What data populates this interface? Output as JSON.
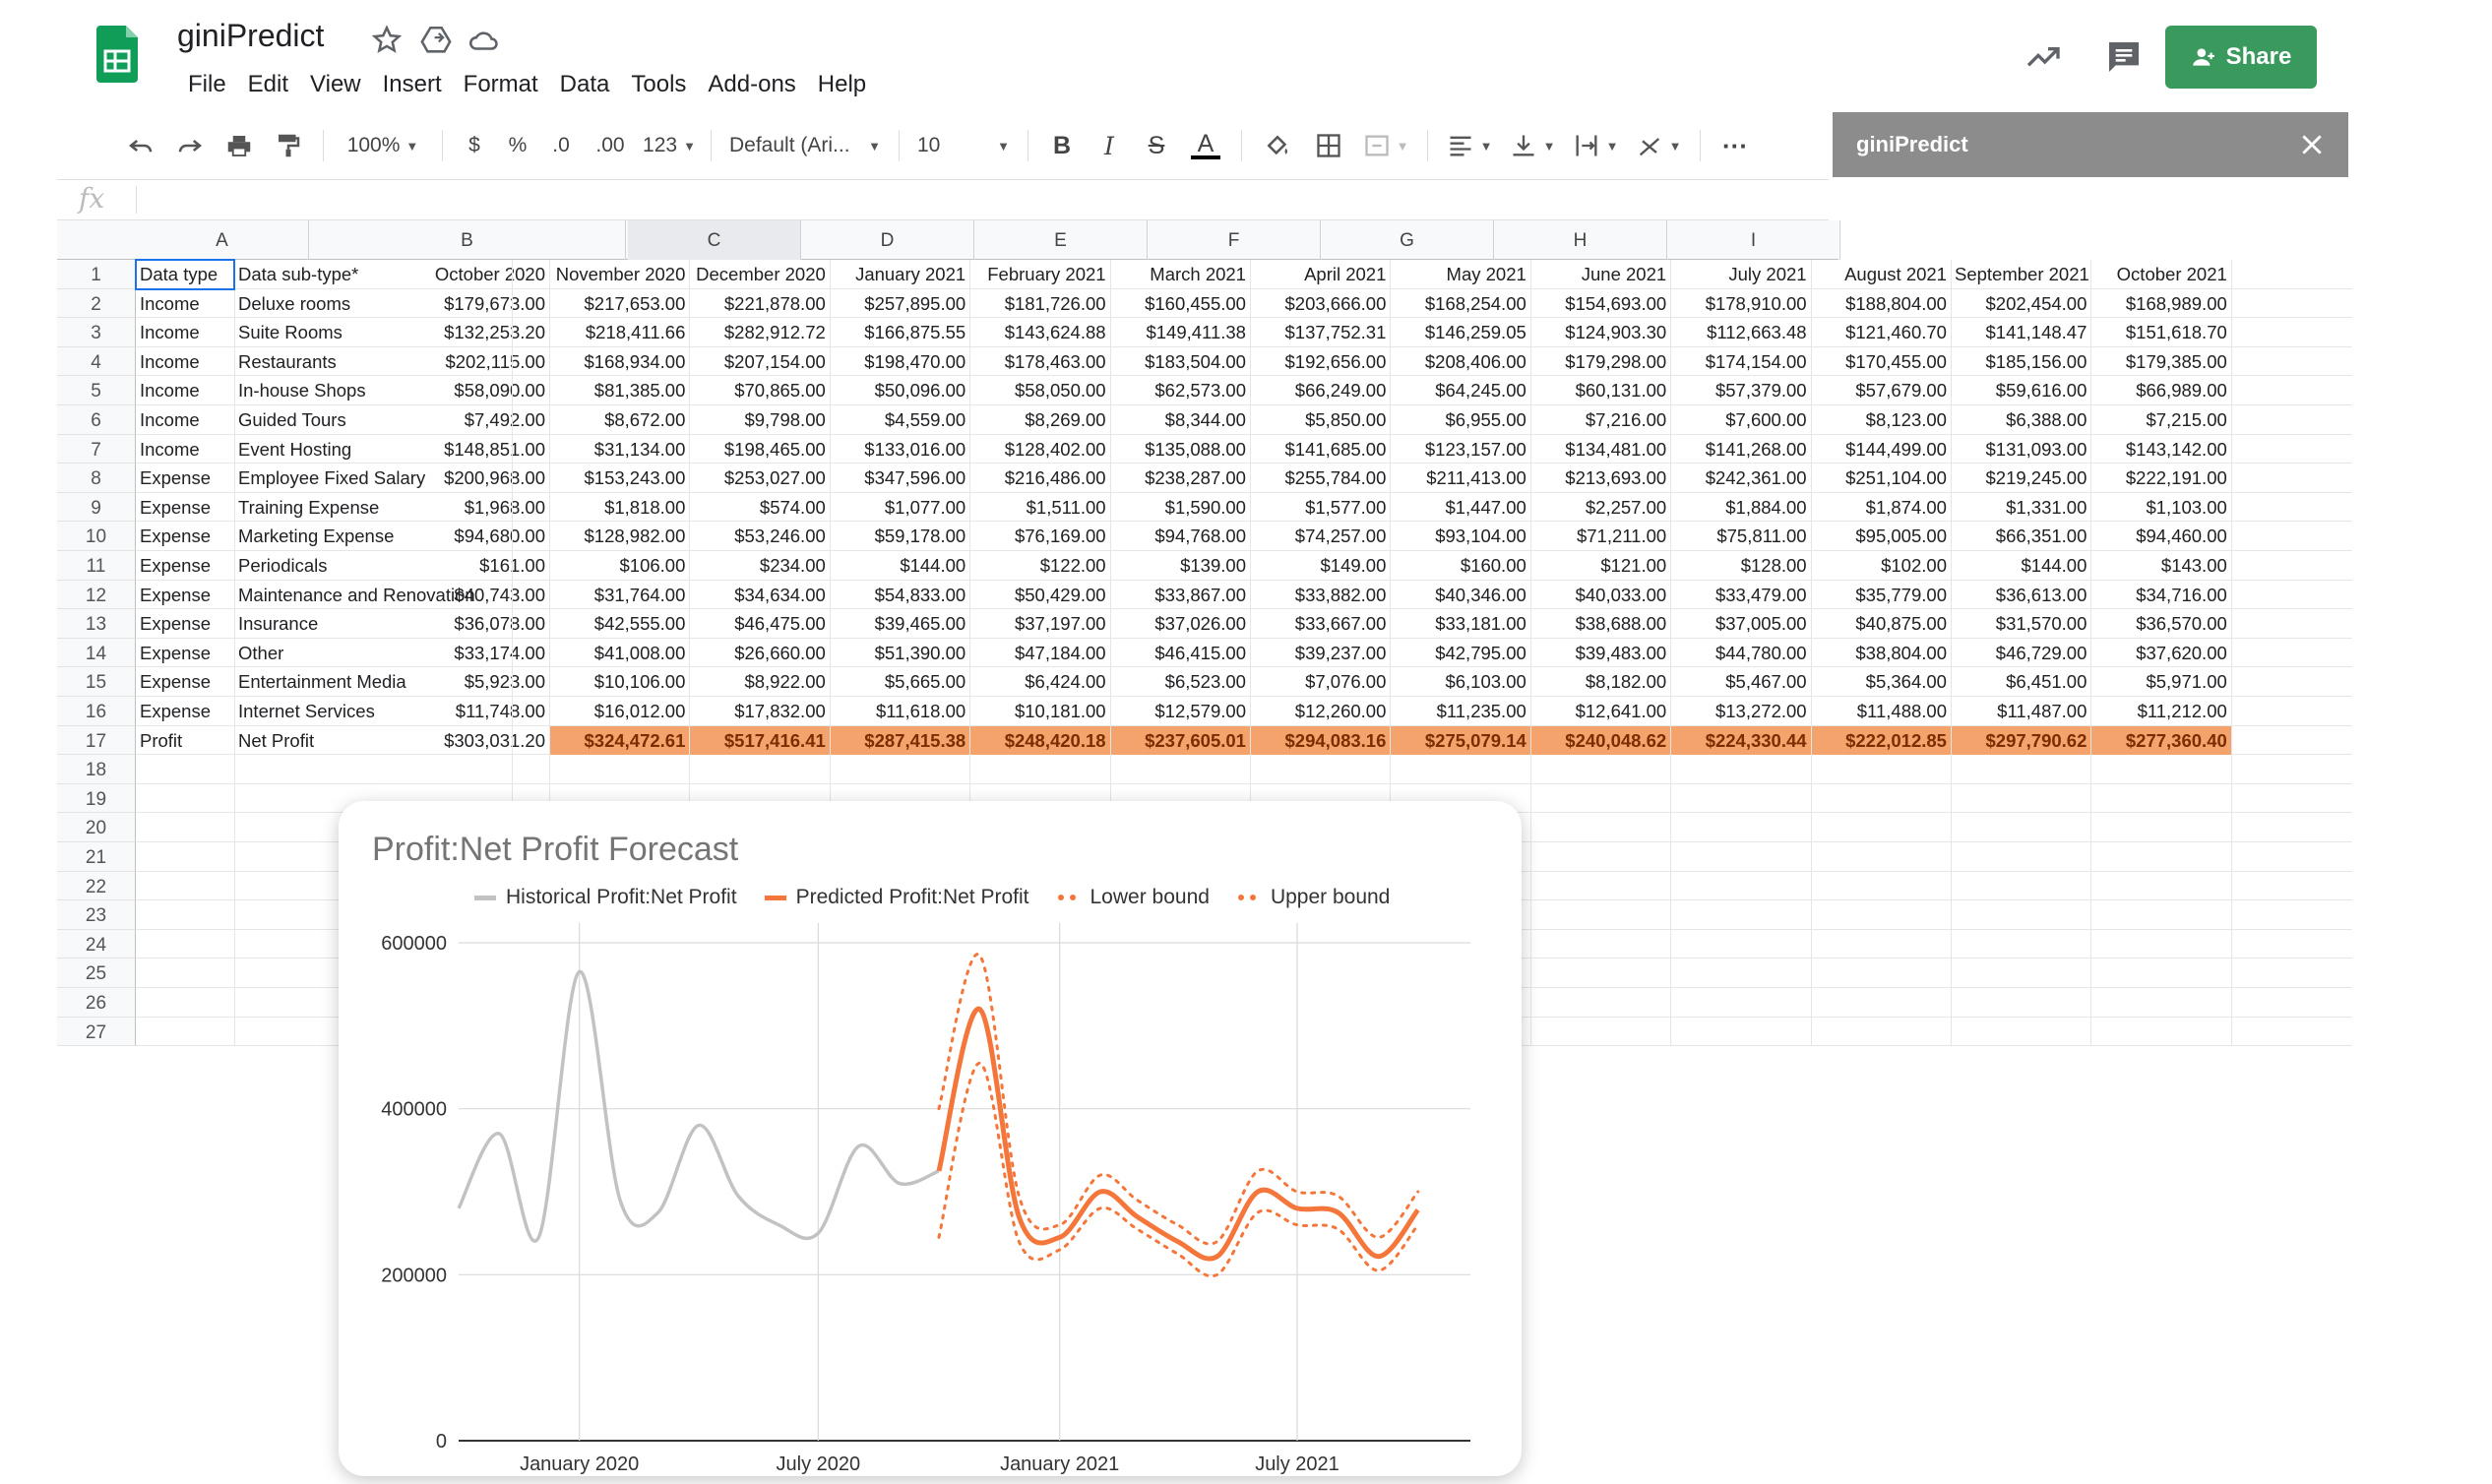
{
  "app": {
    "title": "giniPredict",
    "menus": [
      "File",
      "Edit",
      "View",
      "Insert",
      "Format",
      "Data",
      "Tools",
      "Add-ons",
      "Help"
    ],
    "share_label": "Share",
    "brand_color": "#0f9d58",
    "share_color": "#3a9a5d",
    "icons": [
      "star-icon",
      "move-to-drive-icon",
      "cloud-status-icon",
      "explore-trend-icon",
      "comments-icon"
    ]
  },
  "toolbar": {
    "zoom": "100%",
    "currency": "$",
    "percent": "%",
    "decrease_decimal": ".0",
    "increase_decimal": ".00",
    "more_formats": "123",
    "font": "Default (Ari...",
    "font_size": "10",
    "bold": "B",
    "italic": "I",
    "strike": "S",
    "text_color": "A",
    "more": "···"
  },
  "side_panel": {
    "title": "giniPredict"
  },
  "formula_bar": {
    "fx": "fx"
  },
  "grid": {
    "column_letters": [
      "A",
      "B",
      "C",
      "D",
      "E",
      "F",
      "G",
      "H",
      "I"
    ],
    "row_numbers": [
      "1",
      "2",
      "3",
      "4",
      "5",
      "6",
      "7",
      "8",
      "9",
      "10",
      "11",
      "12",
      "13",
      "14",
      "15",
      "16",
      "17",
      "18",
      "19",
      "20",
      "21",
      "22",
      "23",
      "24",
      "25",
      "26",
      "27"
    ],
    "headers": [
      "Data type",
      "Data sub-type*",
      "October 2020",
      "November 2020",
      "December 2020",
      "January 2021",
      "February 2021",
      "March 2021",
      "April 2021",
      "May 2021",
      "June 2021",
      "July 2021",
      "August 2021",
      "September 2021",
      "October 2021"
    ],
    "rows": [
      [
        "Income",
        "Deluxe rooms",
        "$179,673.00",
        "$217,653.00",
        "$221,878.00",
        "$257,895.00",
        "$181,726.00",
        "$160,455.00",
        "$203,666.00",
        "$168,254.00",
        "$154,693.00",
        "$178,910.00",
        "$188,804.00",
        "$202,454.00",
        "$168,989.00"
      ],
      [
        "Income",
        "Suite Rooms",
        "$132,253.20",
        "$218,411.66",
        "$282,912.72",
        "$166,875.55",
        "$143,624.88",
        "$149,411.38",
        "$137,752.31",
        "$146,259.05",
        "$124,903.30",
        "$112,663.48",
        "$121,460.70",
        "$141,148.47",
        "$151,618.70"
      ],
      [
        "Income",
        "Restaurants",
        "$202,115.00",
        "$168,934.00",
        "$207,154.00",
        "$198,470.00",
        "$178,463.00",
        "$183,504.00",
        "$192,656.00",
        "$208,406.00",
        "$179,298.00",
        "$174,154.00",
        "$170,455.00",
        "$185,156.00",
        "$179,385.00"
      ],
      [
        "Income",
        "In-house Shops",
        "$58,090.00",
        "$81,385.00",
        "$70,865.00",
        "$50,096.00",
        "$58,050.00",
        "$62,573.00",
        "$66,249.00",
        "$64,245.00",
        "$60,131.00",
        "$57,379.00",
        "$57,679.00",
        "$59,616.00",
        "$66,989.00"
      ],
      [
        "Income",
        "Guided Tours",
        "$7,492.00",
        "$8,672.00",
        "$9,798.00",
        "$4,559.00",
        "$8,269.00",
        "$8,344.00",
        "$5,850.00",
        "$6,955.00",
        "$7,216.00",
        "$7,600.00",
        "$8,123.00",
        "$6,388.00",
        "$7,215.00"
      ],
      [
        "Income",
        "Event Hosting",
        "$148,851.00",
        "$31,134.00",
        "$198,465.00",
        "$133,016.00",
        "$128,402.00",
        "$135,088.00",
        "$141,685.00",
        "$123,157.00",
        "$134,481.00",
        "$141,268.00",
        "$144,499.00",
        "$131,093.00",
        "$143,142.00"
      ],
      [
        "Expense",
        "Employee Fixed Salary",
        "$200,968.00",
        "$153,243.00",
        "$253,027.00",
        "$347,596.00",
        "$216,486.00",
        "$238,287.00",
        "$255,784.00",
        "$211,413.00",
        "$213,693.00",
        "$242,361.00",
        "$251,104.00",
        "$219,245.00",
        "$222,191.00"
      ],
      [
        "Expense",
        "Training Expense",
        "$1,968.00",
        "$1,818.00",
        "$574.00",
        "$1,077.00",
        "$1,511.00",
        "$1,590.00",
        "$1,577.00",
        "$1,447.00",
        "$2,257.00",
        "$1,884.00",
        "$1,874.00",
        "$1,331.00",
        "$1,103.00"
      ],
      [
        "Expense",
        "Marketing Expense",
        "$94,680.00",
        "$128,982.00",
        "$53,246.00",
        "$59,178.00",
        "$76,169.00",
        "$94,768.00",
        "$74,257.00",
        "$93,104.00",
        "$71,211.00",
        "$75,811.00",
        "$95,005.00",
        "$66,351.00",
        "$94,460.00"
      ],
      [
        "Expense",
        "Periodicals",
        "$161.00",
        "$106.00",
        "$234.00",
        "$144.00",
        "$122.00",
        "$139.00",
        "$149.00",
        "$160.00",
        "$121.00",
        "$128.00",
        "$102.00",
        "$144.00",
        "$143.00"
      ],
      [
        "Expense",
        "Maintenance and Renovation",
        "$40,743.00",
        "$31,764.00",
        "$34,634.00",
        "$54,833.00",
        "$50,429.00",
        "$33,867.00",
        "$33,882.00",
        "$40,346.00",
        "$40,033.00",
        "$33,479.00",
        "$35,779.00",
        "$36,613.00",
        "$34,716.00"
      ],
      [
        "Expense",
        "Insurance",
        "$36,078.00",
        "$42,555.00",
        "$46,475.00",
        "$39,465.00",
        "$37,197.00",
        "$37,026.00",
        "$33,667.00",
        "$33,181.00",
        "$38,688.00",
        "$37,005.00",
        "$40,875.00",
        "$31,570.00",
        "$36,570.00"
      ],
      [
        "Expense",
        "Other",
        "$33,174.00",
        "$41,008.00",
        "$26,660.00",
        "$51,390.00",
        "$47,184.00",
        "$46,415.00",
        "$39,237.00",
        "$42,795.00",
        "$39,483.00",
        "$44,780.00",
        "$38,804.00",
        "$46,729.00",
        "$37,620.00"
      ],
      [
        "Expense",
        "Entertainment Media",
        "$5,923.00",
        "$10,106.00",
        "$8,922.00",
        "$5,665.00",
        "$6,424.00",
        "$6,523.00",
        "$7,076.00",
        "$6,103.00",
        "$8,182.00",
        "$5,467.00",
        "$5,364.00",
        "$6,451.00",
        "$5,971.00"
      ],
      [
        "Expense",
        "Internet Services",
        "$11,748.00",
        "$16,012.00",
        "$17,832.00",
        "$11,618.00",
        "$10,181.00",
        "$12,579.00",
        "$12,260.00",
        "$11,235.00",
        "$12,641.00",
        "$13,272.00",
        "$11,488.00",
        "$11,487.00",
        "$11,212.00"
      ],
      [
        "Profit",
        "Net Profit",
        "$303,031.20",
        "$324,472.61",
        "$517,416.41",
        "$287,415.38",
        "$248,420.18",
        "$237,605.01",
        "$294,083.16",
        "$275,079.14",
        "$240,048.62",
        "$224,330.44",
        "$222,012.85",
        "$297,790.62",
        "$277,360.40"
      ]
    ],
    "highlight_color": "#f5a36c"
  },
  "chart_data": {
    "type": "line",
    "title": "Profit:Net Profit Forecast",
    "legend": [
      "Historical Profit:Net Profit",
      "Predicted Profit:Net Profit",
      "Lower bound",
      "Upper bound"
    ],
    "colors": {
      "historical": "#c2c2c2",
      "predicted": "#f4763a",
      "bounds": "#f4763a"
    },
    "ylim": [
      0,
      600000
    ],
    "yticks": [
      "600000",
      "400000",
      "200000",
      "0"
    ],
    "xticks": [
      "January 2020",
      "July 2020",
      "January 2021",
      "July 2021"
    ],
    "historical": {
      "x": [
        "2019-10",
        "2019-11",
        "2019-12",
        "2020-01",
        "2020-02",
        "2020-03",
        "2020-04",
        "2020-05",
        "2020-06",
        "2020-07",
        "2020-08",
        "2020-09",
        "2020-10"
      ],
      "y": [
        280000,
        370000,
        245000,
        565000,
        290000,
        275000,
        380000,
        295000,
        260000,
        250000,
        355000,
        310000,
        325000
      ]
    },
    "predicted": {
      "x": [
        "2020-10",
        "2020-11",
        "2020-12",
        "2021-01",
        "2021-02",
        "2021-03",
        "2021-04",
        "2021-05",
        "2021-06",
        "2021-07",
        "2021-08",
        "2021-09",
        "2021-10"
      ],
      "y": [
        325000,
        520000,
        270000,
        245000,
        300000,
        270000,
        240000,
        222000,
        300000,
        280000,
        275000,
        222000,
        278000
      ]
    },
    "lower_bound": [
      245000,
      455000,
      240000,
      230000,
      280000,
      255000,
      225000,
      200000,
      275000,
      260000,
      255000,
      205000,
      260000
    ],
    "upper_bound": [
      400000,
      585000,
      295000,
      260000,
      320000,
      290000,
      260000,
      240000,
      325000,
      300000,
      295000,
      245000,
      300000
    ]
  }
}
